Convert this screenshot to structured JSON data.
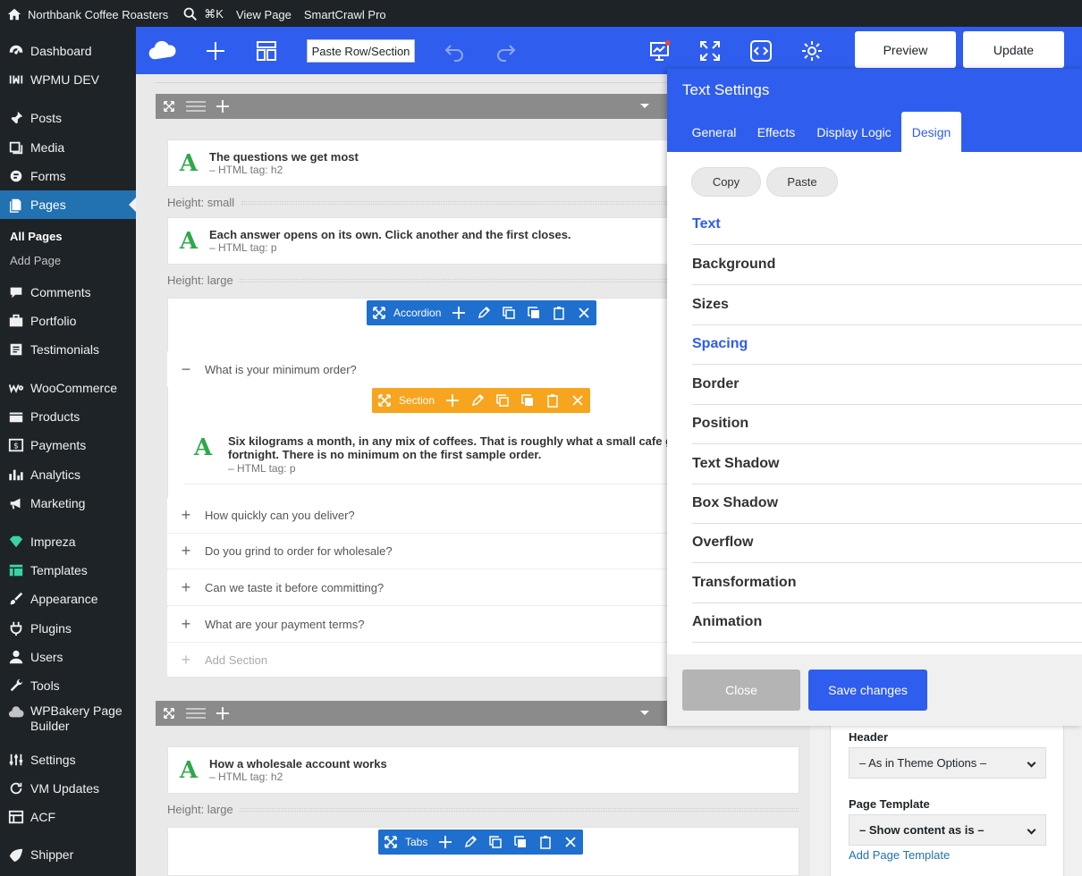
{
  "adminbar": {
    "site_name": "Northbank Coffee Roasters",
    "search_shortcut": "⌘K",
    "view_page": "View Page",
    "plugin": "SmartCrawl Pro"
  },
  "sidebar": {
    "items": [
      {
        "label": "Dashboard",
        "icon": "dashboard-icon"
      },
      {
        "label": "WPMU DEV",
        "icon": "wpmudev-icon"
      },
      {
        "label": "Posts",
        "icon": "pin-icon"
      },
      {
        "label": "Media",
        "icon": "media-icon"
      },
      {
        "label": "Forms",
        "icon": "forms-icon"
      },
      {
        "label": "Pages",
        "icon": "pages-icon",
        "active": true
      },
      {
        "label": "Comments",
        "icon": "comment-icon"
      },
      {
        "label": "Portfolio",
        "icon": "portfolio-icon"
      },
      {
        "label": "Testimonials",
        "icon": "testimonials-icon"
      },
      {
        "label": "WooCommerce",
        "icon": "woocommerce-icon"
      },
      {
        "label": "Products",
        "icon": "products-icon"
      },
      {
        "label": "Payments",
        "icon": "payments-icon"
      },
      {
        "label": "Analytics",
        "icon": "analytics-icon"
      },
      {
        "label": "Marketing",
        "icon": "megaphone-icon"
      },
      {
        "label": "Impreza",
        "icon": "diamond-icon"
      },
      {
        "label": "Templates",
        "icon": "templates-icon"
      },
      {
        "label": "Appearance",
        "icon": "brush-icon"
      },
      {
        "label": "Plugins",
        "icon": "plug-icon"
      },
      {
        "label": "Users",
        "icon": "user-icon"
      },
      {
        "label": "Tools",
        "icon": "wrench-icon"
      },
      {
        "label": "WPBakery Page Builder",
        "icon": "wpbakery-icon"
      },
      {
        "label": "Settings",
        "icon": "settings-icon"
      },
      {
        "label": "VM Updates",
        "icon": "refresh-icon"
      },
      {
        "label": "ACF",
        "icon": "acf-icon"
      },
      {
        "label": "Shipper",
        "icon": "shipper-icon"
      }
    ],
    "submenu": [
      {
        "label": "All Pages",
        "current": true
      },
      {
        "label": "Add Page",
        "current": false
      }
    ]
  },
  "toolbar": {
    "paste_label": "Paste Row/Section",
    "preview": "Preview",
    "update": "Update"
  },
  "canvas": {
    "row1": {
      "heading1": {
        "title": "The questions we get most",
        "tag": "– HTML tag: h2"
      },
      "spacer1": "Height: small",
      "text1": {
        "title": "Each answer opens on its own. Click another and the first closes.",
        "tag": "– HTML tag: p"
      },
      "spacer2": "Height: large",
      "accordion_label": "Accordion",
      "section_label": "Section",
      "open_item": "What is your minimum order?",
      "open_text1": "Six kilograms a month, in any mix of coffees. That is roughly what a small cafe gets",
      "open_text2": "fortnight. There is no minimum on the first sample order.",
      "open_tag": "– HTML tag: p",
      "items": [
        "How quickly can you deliver?",
        "Do you grind to order for wholesale?",
        "Can we taste it before committing?",
        "What are your payment terms?"
      ],
      "add_section": "Add Section"
    },
    "row2": {
      "heading": {
        "title": "How a wholesale account works",
        "tag": "– HTML tag: h2"
      },
      "spacer": "Height: large",
      "tabs_label": "Tabs"
    }
  },
  "panel": {
    "title": "Text Settings",
    "tabs": [
      "General",
      "Effects",
      "Display Logic",
      "Design"
    ],
    "active_tab": "Design",
    "copy": "Copy",
    "paste": "Paste",
    "sections": [
      "Text",
      "Background",
      "Sizes",
      "Spacing",
      "Border",
      "Position",
      "Text Shadow",
      "Box Shadow",
      "Overflow",
      "Transformation",
      "Animation"
    ],
    "highlighted_sections": [
      "Text",
      "Spacing"
    ],
    "close": "Close",
    "save": "Save changes"
  },
  "sidepanel": {
    "header_label": "Header",
    "header_value": "– As in Theme Options –",
    "template_label": "Page Template",
    "template_value": "– Show content as is –",
    "add_template": "Add Page Template"
  },
  "colors": {
    "wp_dark": "#1d2327",
    "wp_blue": "#2271b1",
    "builder_blue": "#2f5ded",
    "section_orange": "#f7a51f",
    "control_blue": "#1f6fcf",
    "green_a": "#2ea84a"
  }
}
